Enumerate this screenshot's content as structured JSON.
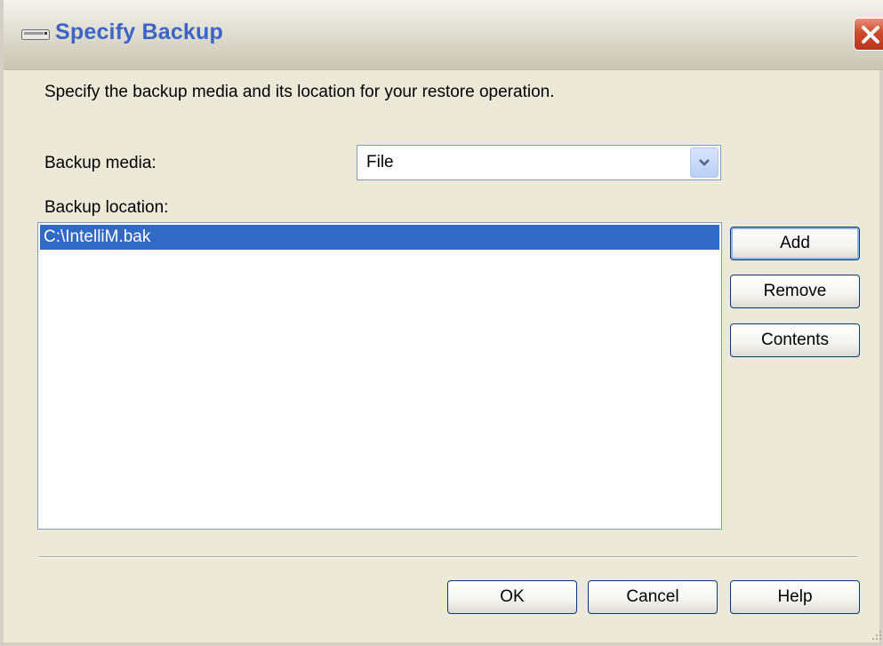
{
  "window": {
    "title": "Specify Backup",
    "title_color": "#3a64c8"
  },
  "dialog": {
    "description": "Specify the backup media and its location for your restore operation.",
    "backup_media_label": "Backup media:",
    "backup_media_value": "File",
    "backup_location_label": "Backup location:",
    "locations": [
      "C:\\IntelliM.bak"
    ]
  },
  "side_buttons": {
    "add": "Add",
    "remove": "Remove",
    "contents": "Contents"
  },
  "footer_buttons": {
    "ok": "OK",
    "cancel": "Cancel",
    "help": "Help"
  },
  "colors": {
    "selection": "#316ac5",
    "dialog_bg": "#ece9d8",
    "close_button": "#cf4a2c"
  }
}
